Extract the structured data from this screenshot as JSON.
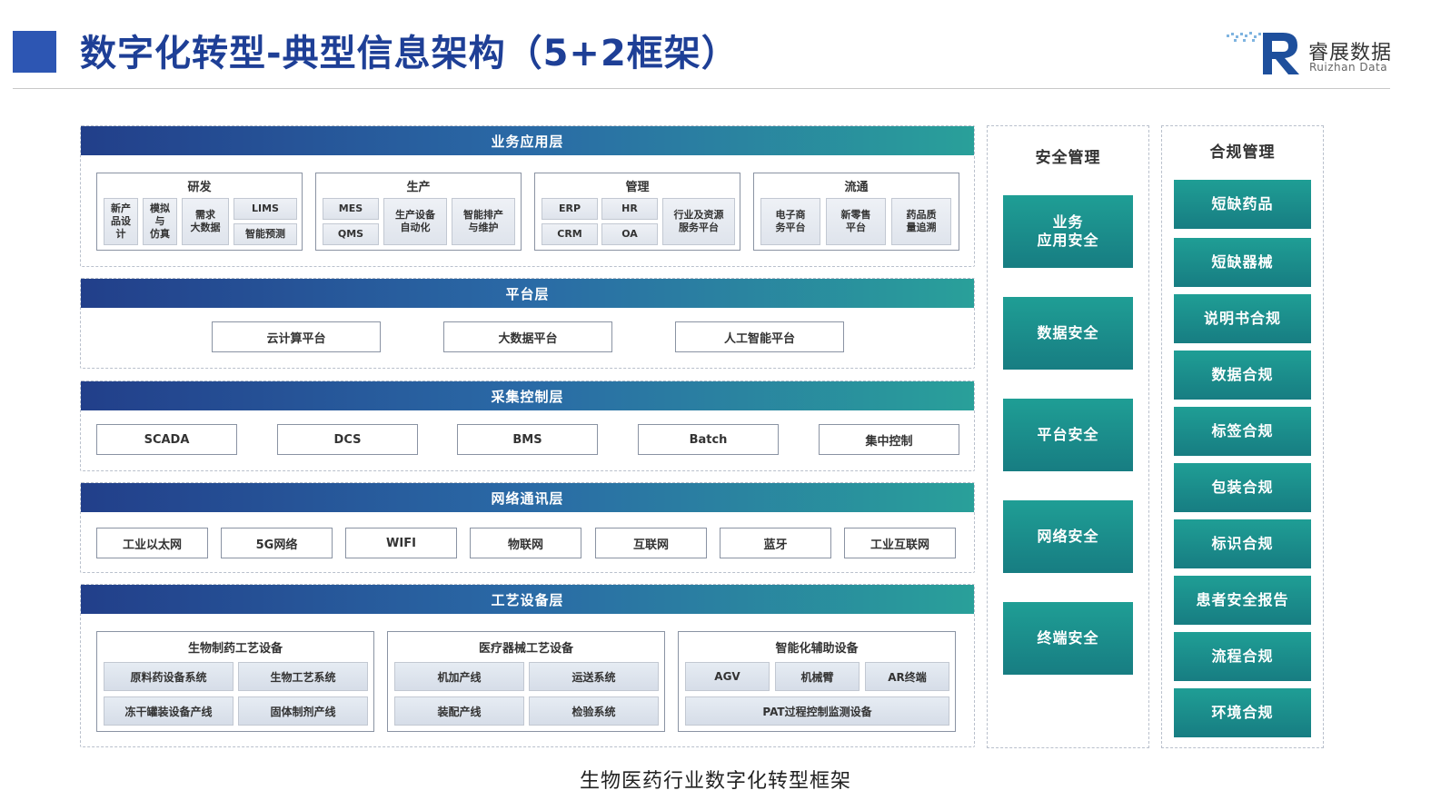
{
  "header": {
    "title": "数字化转型-典型信息架构（5+2框架）",
    "logo_cn": "睿展数据",
    "logo_en": "Ruizhan Data"
  },
  "layers": {
    "business": {
      "title": "业务应用层",
      "groups": [
        {
          "title": "研发",
          "items": [
            "新产\n品设\n计",
            "模拟\n与\n仿真",
            "需求\n大数据",
            "LIMS",
            "智能预测"
          ]
        },
        {
          "title": "生产",
          "items": [
            "MES",
            "QMS",
            "生产设备\n自动化",
            "智能排产\n与维护"
          ]
        },
        {
          "title": "管理",
          "items": [
            "ERP",
            "CRM",
            "HR",
            "OA",
            "行业及资源\n服务平台"
          ]
        },
        {
          "title": "流通",
          "items": [
            "电子商\n务平台",
            "新零售\n平台",
            "药品质\n量追溯"
          ]
        }
      ]
    },
    "platform": {
      "title": "平台层",
      "items": [
        "云计算平台",
        "大数据平台",
        "人工智能平台"
      ]
    },
    "control": {
      "title": "采集控制层",
      "items": [
        "SCADA",
        "DCS",
        "BMS",
        "Batch",
        "集中控制"
      ]
    },
    "network": {
      "title": "网络通讯层",
      "items": [
        "工业以太网",
        "5G网络",
        "WIFI",
        "物联网",
        "互联网",
        "蓝牙",
        "工业互联网"
      ]
    },
    "equipment": {
      "title": "工艺设备层",
      "groups": [
        {
          "title": "生物制药工艺设备",
          "items": [
            "原料药设备系统",
            "生物工艺系统",
            "冻干罐装设备产线",
            "固体制剂产线"
          ]
        },
        {
          "title": "医疗器械工艺设备",
          "items": [
            "机加产线",
            "运送系统",
            "装配产线",
            "检验系统"
          ]
        },
        {
          "title": "智能化辅助设备",
          "items": [
            "AGV",
            "机械臂",
            "AR终端",
            "PAT过程控制监测设备"
          ]
        }
      ]
    }
  },
  "security": {
    "title": "安全管理",
    "items": [
      "业务\n应用安全",
      "数据安全",
      "平台安全",
      "网络安全",
      "终端安全"
    ]
  },
  "compliance": {
    "title": "合规管理",
    "items": [
      "短缺药品",
      "短缺器械",
      "说明书合规",
      "数据合规",
      "标签合规",
      "包装合规",
      "标识合规",
      "患者安全报告",
      "流程合规",
      "环境合规"
    ]
  },
  "caption": "生物医药行业数字化转型框架",
  "colors": {
    "title_blue": "#1e3f96",
    "bar_start": "#223f8a",
    "bar_end": "#29a09a",
    "teal": "#1f9e95"
  }
}
